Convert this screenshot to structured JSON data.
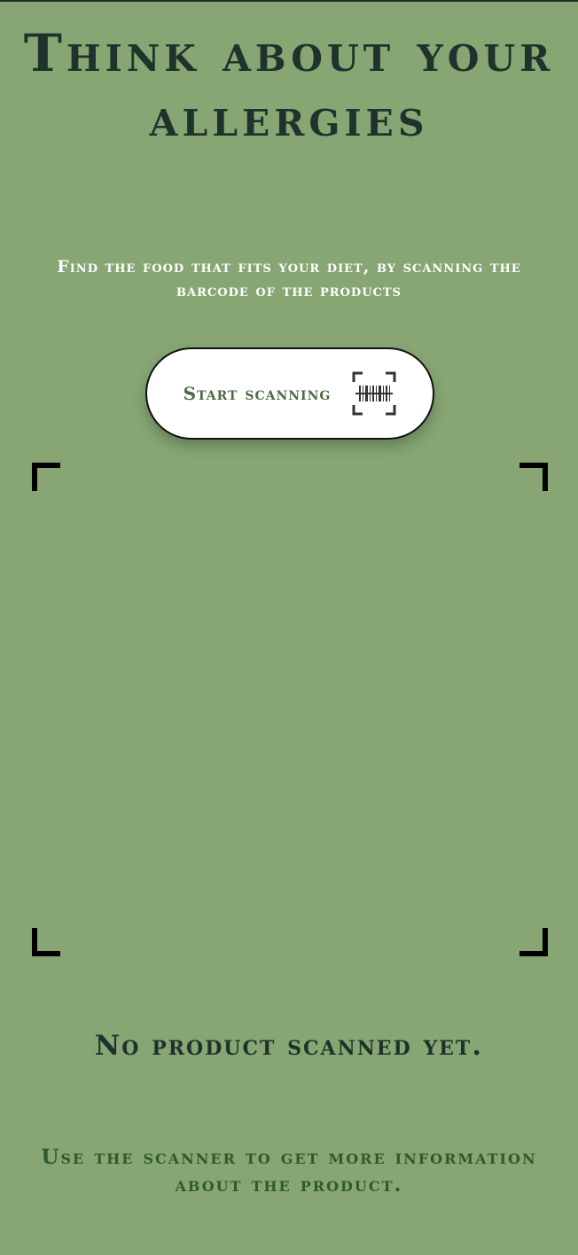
{
  "hero": {
    "title": "Think about your allergies",
    "subtitle": "Find the food that fits your diet, by scanning the barcode of the products"
  },
  "scan_button": {
    "label": "Start scanning",
    "icon": "barcode-scan-icon"
  },
  "scanner": {
    "frame_icon": "viewfinder-corners"
  },
  "status": {
    "message": "No product scanned yet.",
    "hint": "Use the scanner to get more information about the product."
  },
  "colors": {
    "background": "#87a673",
    "title": "#1e332c",
    "subtitle": "#ffffff",
    "button_text": "#4d6b42",
    "hint": "#2f5a2f"
  }
}
